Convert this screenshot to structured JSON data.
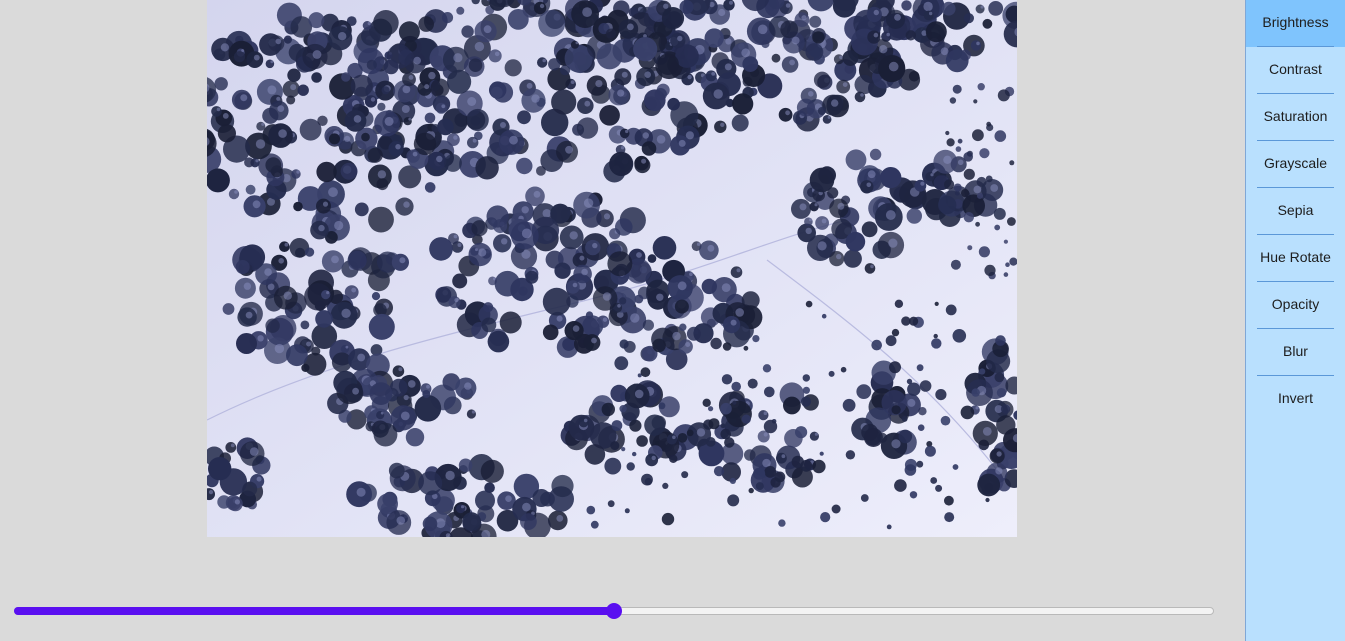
{
  "image": {
    "description_icon": "snowy-forest-photo"
  },
  "slider": {
    "value_fraction": 0.5,
    "fill_color": "#5a0ff0",
    "track_color": "#f3f3f3"
  },
  "sidebar": {
    "active_index": 0,
    "background": "#b9e0fe",
    "active_background": "#7fc4fd",
    "items": [
      {
        "label": "Brightness"
      },
      {
        "label": "Contrast"
      },
      {
        "label": "Saturation"
      },
      {
        "label": "Grayscale"
      },
      {
        "label": "Sepia"
      },
      {
        "label": "Hue Rotate"
      },
      {
        "label": "Opacity"
      },
      {
        "label": "Blur"
      },
      {
        "label": "Invert"
      }
    ]
  }
}
